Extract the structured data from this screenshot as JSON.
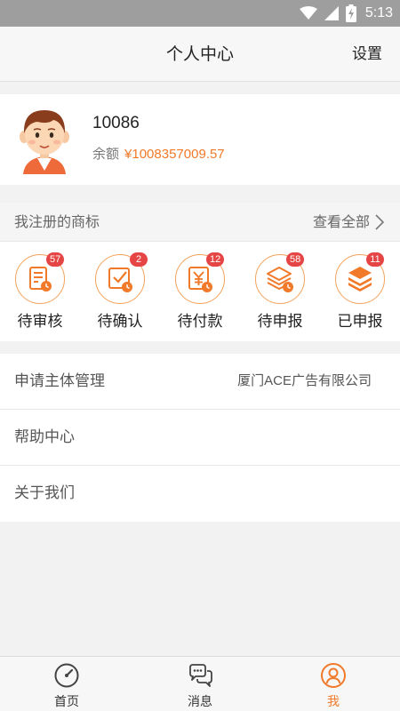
{
  "status_bar": {
    "time": "5:13"
  },
  "header": {
    "title": "个人中心",
    "settings_label": "设置"
  },
  "profile": {
    "username": "10086",
    "balance_label": "余额",
    "balance_amount": "¥1008357009.57"
  },
  "trademarks": {
    "section_label": "我注册的商标",
    "view_all_label": "查看全部",
    "items": [
      {
        "label": "待审核",
        "count": "57",
        "icon": "document-clock-icon"
      },
      {
        "label": "待确认",
        "count": "2",
        "icon": "checkbox-clock-icon"
      },
      {
        "label": "待付款",
        "count": "12",
        "icon": "yuan-clock-icon"
      },
      {
        "label": "待申报",
        "count": "58",
        "icon": "layers-clock-icon"
      },
      {
        "label": "已申报",
        "count": "11",
        "icon": "layers-filled-icon"
      }
    ]
  },
  "menu": {
    "applicant_label": "申请主体管理",
    "applicant_value": "厦门ACE广告有限公司",
    "help_label": "帮助中心",
    "about_label": "关于我们"
  },
  "bottom_nav": {
    "items": [
      {
        "label": "首页",
        "icon": "compass-icon"
      },
      {
        "label": "消息",
        "icon": "chat-bubbles-icon"
      },
      {
        "label": "我",
        "icon": "user-icon",
        "active": true
      }
    ]
  },
  "colors": {
    "accent": "#f07a2a",
    "badge": "#e64545",
    "icon_outline": "#f3a25a"
  }
}
